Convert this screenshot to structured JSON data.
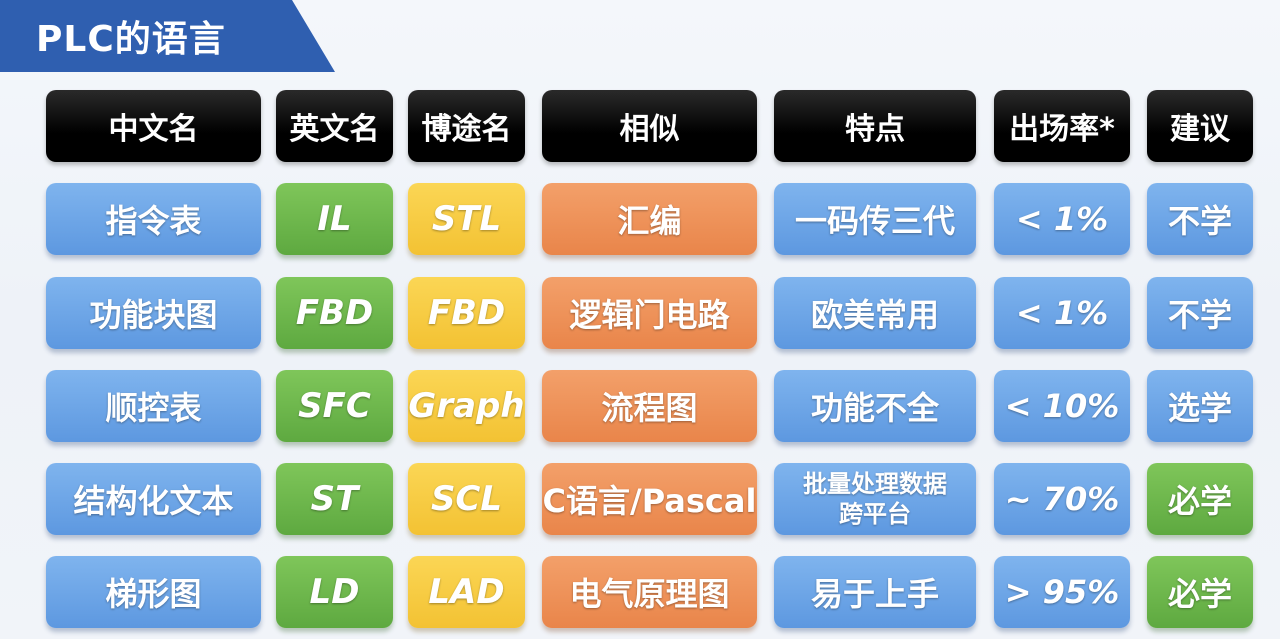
{
  "title": "PLC的语言",
  "headers": [
    "中文名",
    "英文名",
    "博途名",
    "相似",
    "特点",
    "出场率*",
    "建议"
  ],
  "rows": [
    {
      "cn": "指令表",
      "en": "IL",
      "tia": "STL",
      "similar": "汇编",
      "feature": "一码传三代",
      "rate": "< 1%",
      "advice": "不学",
      "advice_color": "blue"
    },
    {
      "cn": "功能块图",
      "en": "FBD",
      "tia": "FBD",
      "similar": "逻辑门电路",
      "feature": "欧美常用",
      "rate": "< 1%",
      "advice": "不学",
      "advice_color": "blue"
    },
    {
      "cn": "顺控表",
      "en": "SFC",
      "tia": "Graph",
      "similar": "流程图",
      "feature": "功能不全",
      "rate": "< 10%",
      "advice": "选学",
      "advice_color": "blue"
    },
    {
      "cn": "结构化文本",
      "en": "ST",
      "tia": "SCL",
      "similar": "C语言/Pascal",
      "feature": "批量处理数据\n跨平台",
      "rate": "~ 70%",
      "advice": "必学",
      "advice_color": "green"
    },
    {
      "cn": "梯形图",
      "en": "LD",
      "tia": "LAD",
      "similar": "电气原理图",
      "feature": "易于上手",
      "rate": "> 95%",
      "advice": "必学",
      "advice_color": "green"
    }
  ],
  "colors": {
    "title_banner": "#2f5fb0",
    "header": "#000000",
    "blue": "#6aa6e8",
    "green": "#6bb84b",
    "yellow": "#f7cb3d",
    "orange": "#ee9255"
  }
}
